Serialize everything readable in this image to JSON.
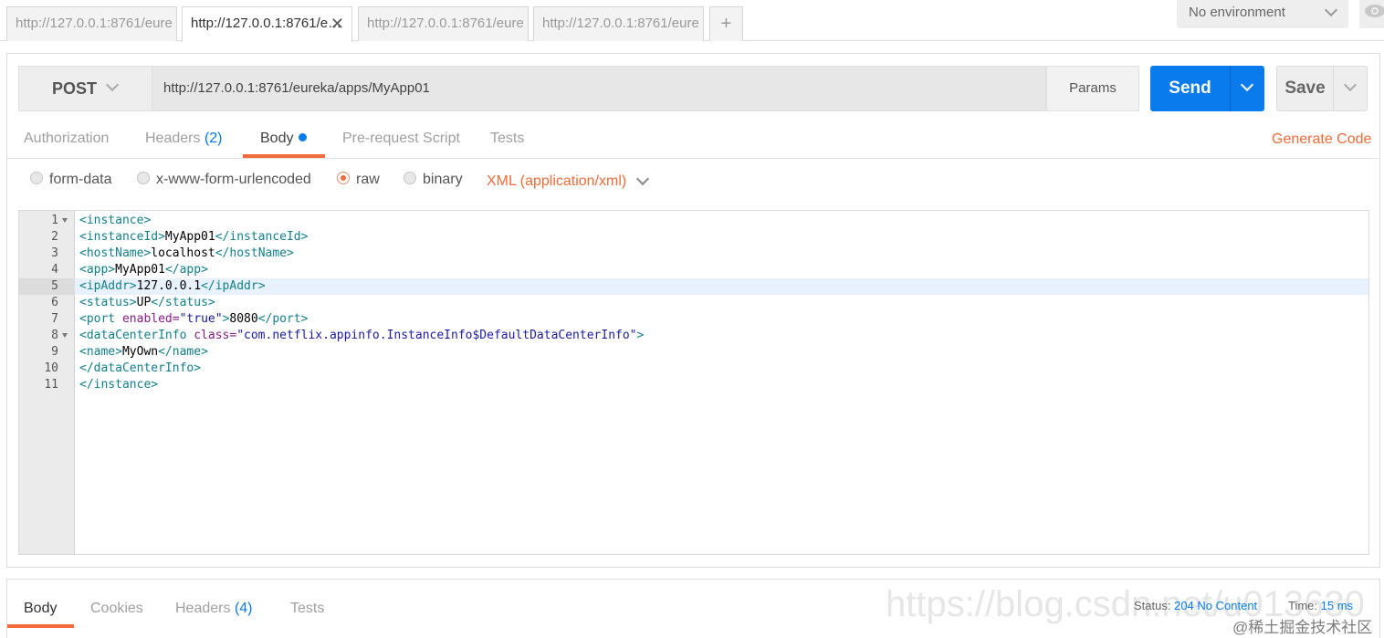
{
  "tabs": [
    {
      "label": "http://127.0.0.1:8761/eure"
    },
    {
      "label": "http://127.0.0.1:8761/e…"
    },
    {
      "label": "http://127.0.0.1:8761/eure"
    },
    {
      "label": "http://127.0.0.1:8761/eure"
    }
  ],
  "tab_add": "+",
  "tab_close": "✕",
  "environment": "No environment",
  "request": {
    "method": "POST",
    "url": "http://127.0.0.1:8761/eureka/apps/MyApp01",
    "params_label": "Params",
    "send_label": "Send",
    "save_label": "Save"
  },
  "subtabs": {
    "authorization": "Authorization",
    "headers": "Headers",
    "headers_count": "(2)",
    "body": "Body",
    "prerequest": "Pre-request Script",
    "tests": "Tests",
    "generate_code": "Generate Code"
  },
  "body_types": {
    "form_data": "form-data",
    "urlencoded": "x-www-form-urlencoded",
    "raw": "raw",
    "binary": "binary",
    "selected": "raw",
    "content_type": "XML (application/xml)"
  },
  "editor": {
    "highlighted_line": 5,
    "lines": [
      {
        "n": "1",
        "parts": [
          [
            "t",
            "<instance>"
          ]
        ]
      },
      {
        "n": "2",
        "parts": [
          [
            "t",
            "<instanceId>"
          ],
          [
            "x",
            "MyApp01"
          ],
          [
            "t",
            "</instanceId>"
          ]
        ]
      },
      {
        "n": "3",
        "parts": [
          [
            "t",
            "<hostName>"
          ],
          [
            "x",
            "localhost"
          ],
          [
            "t",
            "</hostName>"
          ]
        ]
      },
      {
        "n": "4",
        "parts": [
          [
            "t",
            "<app>"
          ],
          [
            "x",
            "MyApp01"
          ],
          [
            "t",
            "</app>"
          ]
        ]
      },
      {
        "n": "5",
        "parts": [
          [
            "t",
            "<ipAddr>"
          ],
          [
            "x",
            "127.0.0.1"
          ],
          [
            "t",
            "</ipAddr>"
          ]
        ]
      },
      {
        "n": "6",
        "parts": [
          [
            "t",
            "<status>"
          ],
          [
            "x",
            "UP"
          ],
          [
            "t",
            "</status>"
          ]
        ]
      },
      {
        "n": "7",
        "parts": [
          [
            "t",
            "<port "
          ],
          [
            "a",
            "enabled="
          ],
          [
            "s",
            "\"true\""
          ],
          [
            "t",
            ">"
          ],
          [
            "x",
            "8080"
          ],
          [
            "t",
            "</port>"
          ]
        ]
      },
      {
        "n": "8",
        "parts": [
          [
            "t",
            "<dataCenterInfo "
          ],
          [
            "a",
            "class="
          ],
          [
            "s",
            "\"com.netflix.appinfo.InstanceInfo$DefaultDataCenterInfo\""
          ],
          [
            "t",
            ">"
          ]
        ]
      },
      {
        "n": "9",
        "parts": [
          [
            "t",
            "<name>"
          ],
          [
            "x",
            "MyOwn"
          ],
          [
            "t",
            "</name>"
          ]
        ]
      },
      {
        "n": "10",
        "parts": [
          [
            "t",
            "</dataCenterInfo>"
          ]
        ]
      },
      {
        "n": "11",
        "parts": [
          [
            "t",
            "</instance>"
          ]
        ]
      }
    ],
    "foldable": [
      "1",
      "8"
    ]
  },
  "response": {
    "tabs": {
      "body": "Body",
      "cookies": "Cookies",
      "headers": "Headers",
      "headers_count": "(4)",
      "tests": "Tests"
    },
    "status_label": "Status:",
    "status_value": "204 No Content",
    "time_label": "Time:",
    "time_value": "15 ms"
  },
  "watermark": "https://blog.csdn.net/u013630",
  "watermark_site": "@稀土掘金技术社区",
  "colors": {
    "accent_orange": "#f26b3a",
    "send_blue": "#097bed",
    "xml_tag": "#117f8c",
    "xml_attr": "#8a1c8a",
    "xml_string": "#1a1aa6"
  }
}
